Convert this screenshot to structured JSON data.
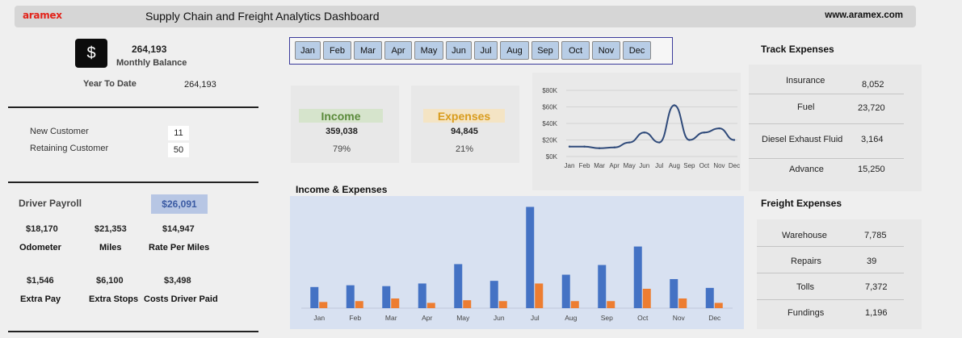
{
  "header": {
    "logo": "aramex",
    "title": "Supply Chain and Freight Analytics Dashboard",
    "url": "www.aramex.com"
  },
  "balance": {
    "icon": "dollar-icon",
    "symbol": "$",
    "value": "264,193",
    "label": "Monthly Balance",
    "ytd_label": "Year To Date",
    "ytd_value": "264,193"
  },
  "customers": {
    "new_label": "New Customer",
    "new_value": "11",
    "retaining_label": "Retaining Customer",
    "retaining_value": "50"
  },
  "payroll": {
    "label": "Driver Payroll",
    "value": "$26,091",
    "items": [
      {
        "value": "$18,170",
        "label": "Odometer"
      },
      {
        "value": "$21,353",
        "label": "Miles"
      },
      {
        "value": "$14,947",
        "label": "Rate Per Miles"
      },
      {
        "value": "$1,546",
        "label": "Extra Pay"
      },
      {
        "value": "$6,100",
        "label": "Extra Stops"
      },
      {
        "value": "$3,498",
        "label": "Costs Driver Paid"
      }
    ]
  },
  "slicer": {
    "months": [
      "Jan",
      "Feb",
      "Mar",
      "Apr",
      "May",
      "Jun",
      "Jul",
      "Aug",
      "Sep",
      "Oct",
      "Nov",
      "Dec"
    ]
  },
  "income": {
    "title": "Income",
    "value": "359,038",
    "percent": "79%",
    "color": "#5a8a3a",
    "bar": "#d6e4cc"
  },
  "expenses": {
    "title": "Expenses",
    "value": "94,845",
    "percent": "21%",
    "color": "#d89b1c",
    "bar": "#f4e4c4"
  },
  "track_expenses": {
    "title": "Track Expenses",
    "rows": [
      {
        "label": "Insurance",
        "value": "8,052"
      },
      {
        "label": "Fuel",
        "value": "23,720"
      },
      {
        "label": "Diesel Exhaust Fluid",
        "value": "3,164"
      },
      {
        "label": "Advance",
        "value": "15,250"
      }
    ]
  },
  "freight_expenses": {
    "title": "Freight Expenses",
    "rows": [
      {
        "label": "Warehouse",
        "value": "7,785"
      },
      {
        "label": "Repairs",
        "value": "39"
      },
      {
        "label": "Tolls",
        "value": "7,372"
      },
      {
        "label": "Fundings",
        "value": "1,196"
      }
    ]
  },
  "chart_data": [
    {
      "type": "line",
      "title": "",
      "categories": [
        "Jan",
        "Feb",
        "Mar",
        "Apr",
        "May",
        "Jun",
        "Jul",
        "Aug",
        "Sep",
        "Oct",
        "Nov",
        "Dec"
      ],
      "series": [
        {
          "values": [
            12000,
            12000,
            10000,
            11000,
            17000,
            29000,
            17000,
            62000,
            20000,
            29000,
            34000,
            20000
          ]
        }
      ],
      "y_ticks": [
        "$0K",
        "$20K",
        "$40K",
        "$60K",
        "$80K"
      ],
      "ylim": [
        0,
        80000
      ],
      "color": "#2f4a7a",
      "grid": true
    },
    {
      "type": "bar",
      "title": "Income & Expenses",
      "categories": [
        "Jan",
        "Feb",
        "Mar",
        "Apr",
        "May",
        "Jun",
        "Jul",
        "Aug",
        "Sep",
        "Oct",
        "Nov",
        "Dec"
      ],
      "series": [
        {
          "values": [
            24,
            26,
            25,
            28,
            50,
            31,
            115,
            38,
            49,
            70,
            33,
            23
          ],
          "color": "#4472c4"
        },
        {
          "values": [
            7,
            8,
            11,
            6,
            9,
            8,
            28,
            8,
            8,
            22,
            11,
            6
          ],
          "color": "#ed7d31"
        }
      ],
      "ylim": [
        0,
        120
      ],
      "grid": false
    }
  ]
}
